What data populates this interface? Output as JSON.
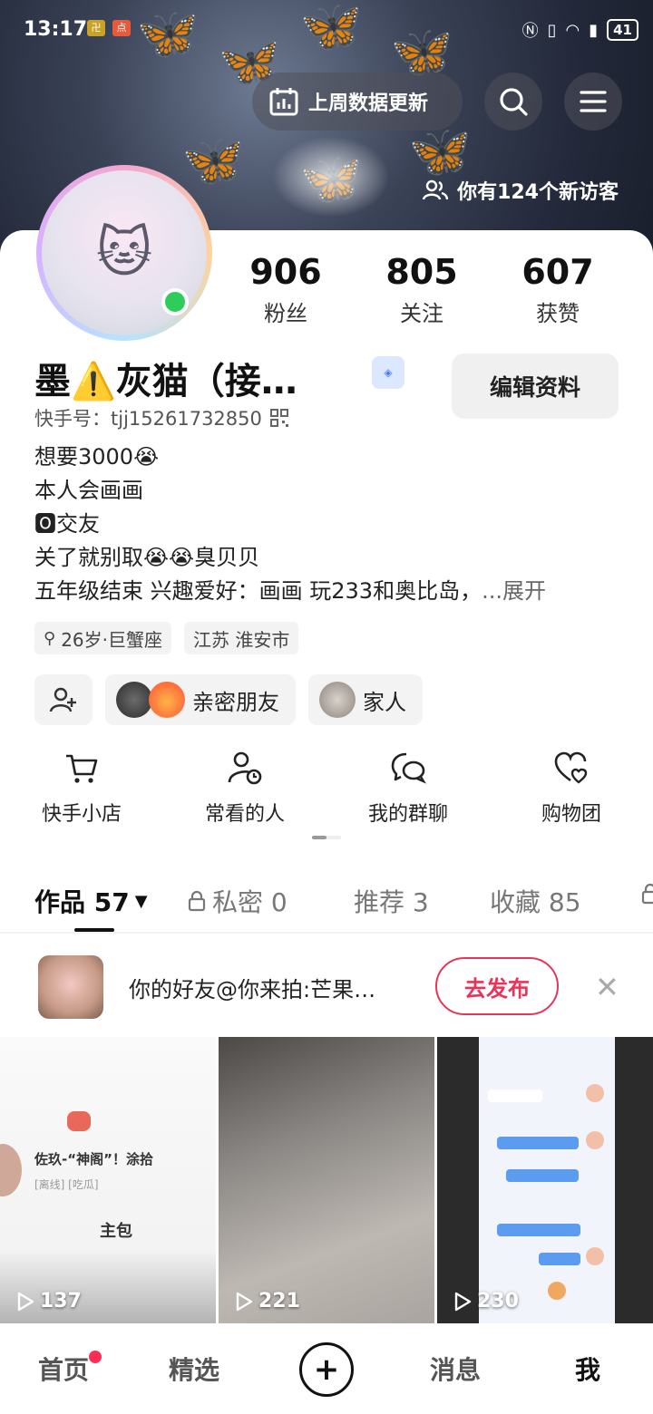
{
  "status_bar": {
    "time": "13:17",
    "battery": "41"
  },
  "header": {
    "weekly_data_label": "上周数据更新",
    "visitors_text": "你有124个新访客"
  },
  "profile": {
    "name": "墨⚠️灰猫（接…",
    "kuaishou_id": "快手号：tjj15261732850",
    "edit_button": "编辑资料",
    "stats": [
      {
        "value": "906",
        "label": "粉丝"
      },
      {
        "value": "805",
        "label": "关注"
      },
      {
        "value": "607",
        "label": "获赞"
      }
    ],
    "bio_lines": [
      "想要3000😭",
      "本人会画画",
      "🅾交友",
      "关了就别取😭😭臭贝贝",
      "五年级结束 兴趣爱好：画画 玩233和奥比岛，"
    ],
    "expand_label": "...展开",
    "tags": [
      "26岁·巨蟹座",
      "江苏 淮安市"
    ],
    "relation_chips": [
      "亲密朋友",
      "家人"
    ]
  },
  "quick_actions": [
    {
      "label": "快手小店",
      "icon": "cart-icon"
    },
    {
      "label": "常看的人",
      "icon": "person-clock-icon"
    },
    {
      "label": "我的群聊",
      "icon": "chat-bubbles-icon"
    },
    {
      "label": "购物团",
      "icon": "heart-group-icon"
    }
  ],
  "tabs": [
    {
      "label": "作品 57",
      "active": true
    },
    {
      "label": "私密 0",
      "active": false
    },
    {
      "label": "推荐 3",
      "active": false
    },
    {
      "label": "收藏 85",
      "active": false
    }
  ],
  "invite": {
    "text": "你的好友@你来拍:芒果…",
    "button": "去发布"
  },
  "videos": [
    {
      "views": "137",
      "caption": "佐玖-“神阁”！涂拾",
      "sub": "[离线] [吃瓜]",
      "main": "主包"
    },
    {
      "views": "221"
    },
    {
      "views": "230"
    }
  ],
  "bottom_nav": {
    "home": "首页",
    "featured": "精选",
    "messages": "消息",
    "me": "我"
  }
}
